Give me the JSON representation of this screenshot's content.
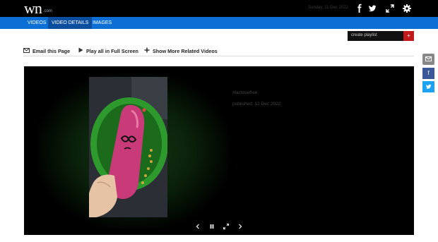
{
  "header": {
    "logo_main": "wn",
    "logo_suffix": ".com",
    "date_text": "Sunday, 11 Dec 2022",
    "icons": [
      "facebook-icon",
      "twitter-icon",
      "expand-icon",
      "settings-icon"
    ]
  },
  "nav": {
    "tabs": [
      {
        "label": "VIDEOS",
        "active": false
      },
      {
        "label": "VIDEO DETAILS",
        "active": true
      },
      {
        "label": "IMAGES",
        "active": false
      }
    ]
  },
  "playlist": {
    "placeholder": "create playlist",
    "add_label": "+"
  },
  "actions": {
    "email": "Email this Page",
    "play_all": "Play all in Full Screen",
    "more_related": "Show More Related Videos"
  },
  "video": {
    "tag": "#lactosefree",
    "published": "published: 12 Dec 2022"
  },
  "colors": {
    "nav_blue": "#0b6fd6",
    "nav_active": "#0a4e9f",
    "playlist_add": "#c21a1a",
    "facebook": "#3b5998",
    "twitter": "#1da1f2"
  }
}
